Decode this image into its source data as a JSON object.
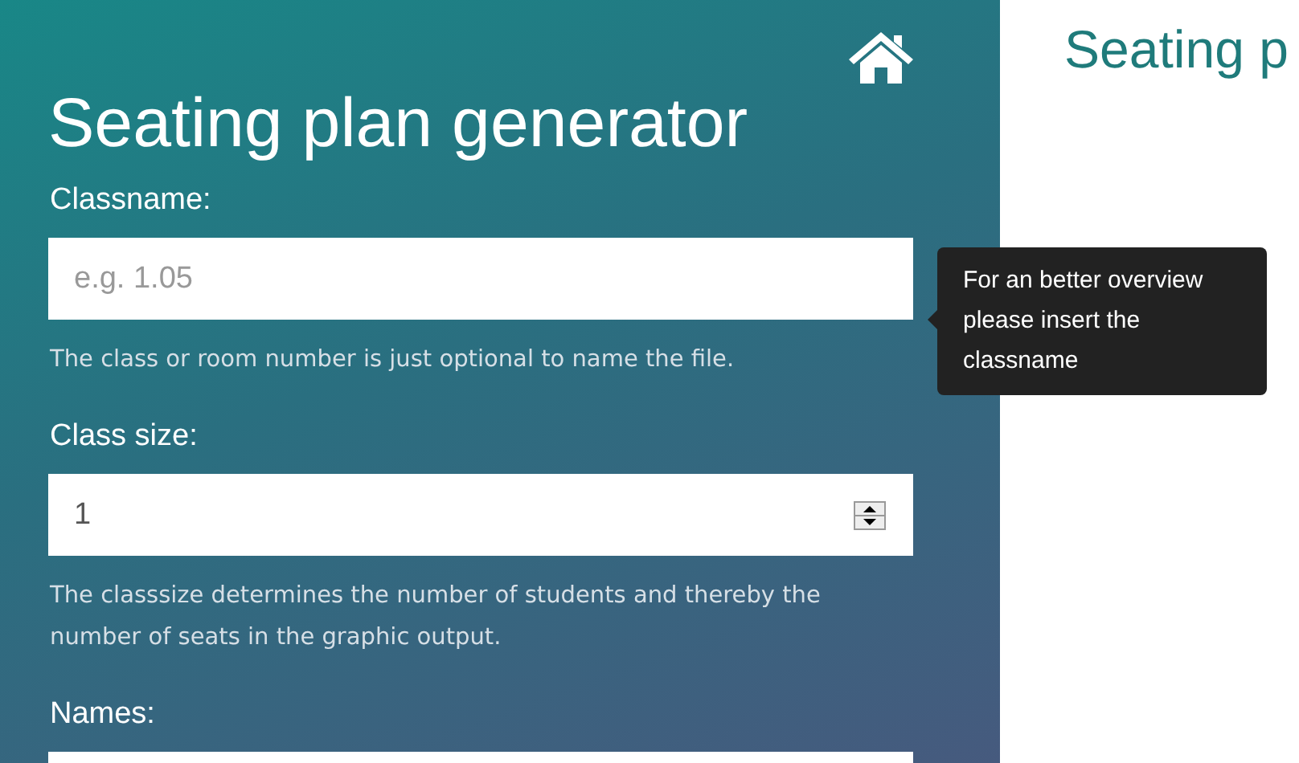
{
  "sidebar": {
    "title": "Seating plan generator",
    "fields": [
      {
        "kind": "text",
        "label": "Classname:",
        "placeholder": "e.g. 1.05",
        "help": "The class or room number is just optional to name the file.",
        "tooltip": "For an better overview please insert the classname"
      },
      {
        "kind": "number",
        "label": "Class size:",
        "value": "1",
        "help": "The classsize determines the number of students and thereby the number of seats in the graphic output."
      },
      {
        "kind": "textarea",
        "label": "Names:"
      }
    ]
  },
  "main": {
    "heading": "Seating p"
  }
}
